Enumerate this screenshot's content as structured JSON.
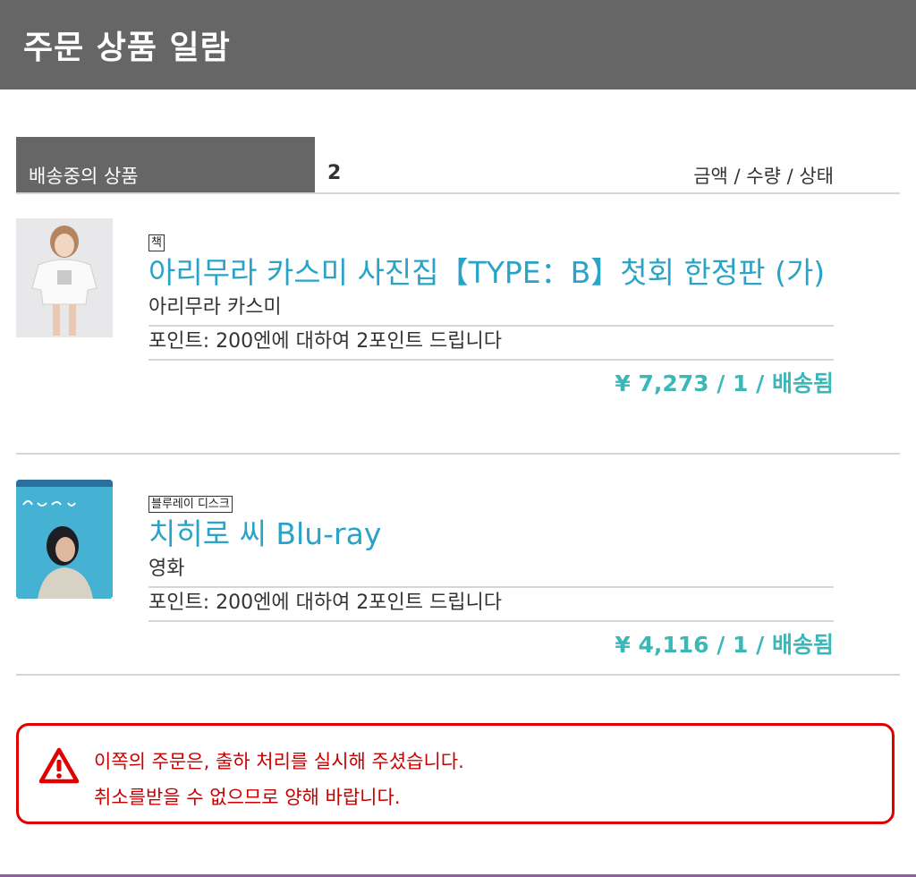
{
  "header": {
    "title": "주문 상품 일람"
  },
  "section": {
    "tab_label": "배송중의 상품",
    "count": "2",
    "columns_label": "금액 / 수량 / 상태"
  },
  "items": [
    {
      "badge": "책",
      "title": "아리무라 카스미 사진집【TYPE：B】첫회 한정판 (가)",
      "subtitle": "아리무라 카스미",
      "points": "포인트: 200엔에 대하여 2포인트 드립니다",
      "price_line": "¥ 7,273 / 1 / 배송됨"
    },
    {
      "badge": "블루레이 디스크",
      "title": "치히로 씨 Blu-ray",
      "subtitle": "영화",
      "points": "포인트: 200엔에 대하여 2포인트 드립니다",
      "price_line": "¥ 4,116 / 1 / 배송됨"
    }
  ],
  "warning": {
    "line1": "이쪽의 주문은, 출하 처리를 실시해 주셨습니다.",
    "line2": "취소를받을 수 없으므로 양해 바랍니다.",
    "icon": "warning-triangle-icon",
    "color": "#e00000"
  },
  "colors": {
    "header_bg": "#666666",
    "link": "#2ba3c6",
    "price": "#3cb7b7"
  }
}
